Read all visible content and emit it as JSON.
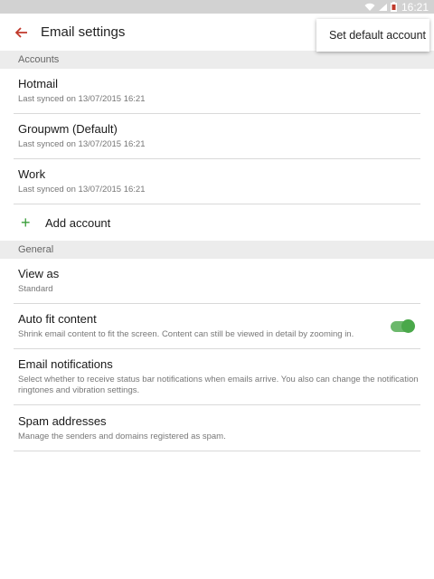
{
  "status_bar": {
    "time": "16:21"
  },
  "app_bar": {
    "title": "Email settings"
  },
  "menu": {
    "set_default_account": "Set default account"
  },
  "sections": {
    "accounts": "Accounts",
    "general": "General"
  },
  "accounts": [
    {
      "name": "Hotmail",
      "synced": "Last synced on 13/07/2015 16:21"
    },
    {
      "name": "Groupwm (Default)",
      "synced": "Last synced on 13/07/2015 16:21"
    },
    {
      "name": "Work",
      "synced": "Last synced on 13/07/2015 16:21"
    }
  ],
  "add_account": {
    "label": "Add account",
    "icon": "+"
  },
  "general": {
    "view_as": {
      "title": "View as",
      "value": "Standard"
    },
    "auto_fit": {
      "title": "Auto fit content",
      "desc": "Shrink email content to fit the screen. Content can still be viewed in detail by zooming in.",
      "enabled": true
    },
    "notifications": {
      "title": "Email notifications",
      "desc": "Select whether to receive status bar notifications when emails arrive. You also can change the notification ringtones and vibration settings."
    },
    "spam": {
      "title": "Spam addresses",
      "desc": "Manage the senders and domains registered as spam."
    }
  },
  "colors": {
    "accent_back": "#c0392b",
    "toggle": "#4aa84a",
    "plus": "#3a9e3a"
  }
}
